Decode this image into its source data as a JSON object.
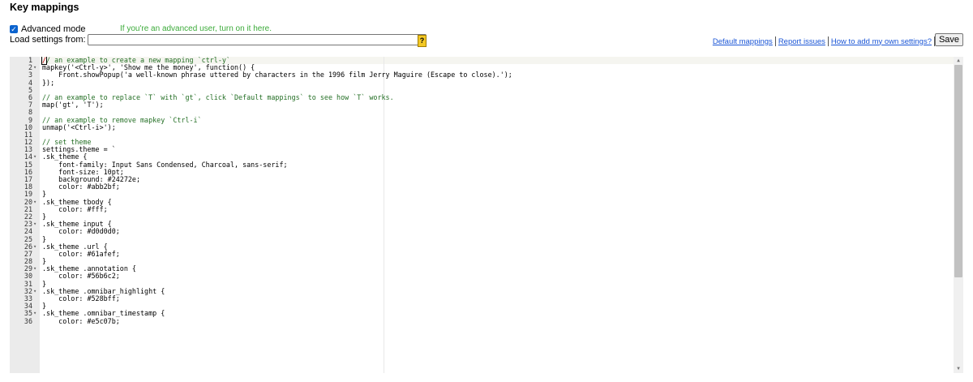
{
  "heading": "Key mappings",
  "advanced": {
    "label": "Advanced mode",
    "checked": true,
    "hint": "If you're an advanced user, turn on it here."
  },
  "load": {
    "label": "Load settings from:",
    "value": "",
    "help_icon": "?"
  },
  "links": {
    "default_mappings": "Default mappings",
    "report_issues": "Report issues",
    "how_to_add": "How to add my own settings?"
  },
  "save_label": "Save",
  "editor": {
    "lines": [
      {
        "n": "1",
        "fold": "",
        "text": "// an example to create a new mapping `ctrl-y`",
        "cls": "comment"
      },
      {
        "n": "2",
        "fold": "▾",
        "text": "mapkey('<Ctrl-y>', 'Show me the money', function() {",
        "cls": ""
      },
      {
        "n": "3",
        "fold": "",
        "text": "    Front.showPopup('a well-known phrase uttered by characters in the 1996 film Jerry Maguire (Escape to close).');",
        "cls": ""
      },
      {
        "n": "4",
        "fold": "",
        "text": "});",
        "cls": ""
      },
      {
        "n": "5",
        "fold": "",
        "text": "",
        "cls": ""
      },
      {
        "n": "6",
        "fold": "",
        "text": "// an example to replace `T` with `gt`, click `Default mappings` to see how `T` works.",
        "cls": "comment"
      },
      {
        "n": "7",
        "fold": "",
        "text": "map('gt', 'T');",
        "cls": ""
      },
      {
        "n": "8",
        "fold": "",
        "text": "",
        "cls": ""
      },
      {
        "n": "9",
        "fold": "",
        "text": "// an example to remove mapkey `Ctrl-i`",
        "cls": "comment"
      },
      {
        "n": "10",
        "fold": "",
        "text": "unmap('<Ctrl-i>');",
        "cls": ""
      },
      {
        "n": "11",
        "fold": "",
        "text": "",
        "cls": ""
      },
      {
        "n": "12",
        "fold": "",
        "text": "// set theme",
        "cls": "comment"
      },
      {
        "n": "13",
        "fold": "",
        "text": "settings.theme = `",
        "cls": ""
      },
      {
        "n": "14",
        "fold": "▾",
        "text": ".sk_theme {",
        "cls": ""
      },
      {
        "n": "15",
        "fold": "",
        "text": "    font-family: Input Sans Condensed, Charcoal, sans-serif;",
        "cls": ""
      },
      {
        "n": "16",
        "fold": "",
        "text": "    font-size: 10pt;",
        "cls": ""
      },
      {
        "n": "17",
        "fold": "",
        "text": "    background: #24272e;",
        "cls": ""
      },
      {
        "n": "18",
        "fold": "",
        "text": "    color: #abb2bf;",
        "cls": ""
      },
      {
        "n": "19",
        "fold": "",
        "text": "}",
        "cls": ""
      },
      {
        "n": "20",
        "fold": "▾",
        "text": ".sk_theme tbody {",
        "cls": ""
      },
      {
        "n": "21",
        "fold": "",
        "text": "    color: #fff;",
        "cls": ""
      },
      {
        "n": "22",
        "fold": "",
        "text": "}",
        "cls": ""
      },
      {
        "n": "23",
        "fold": "▾",
        "text": ".sk_theme input {",
        "cls": ""
      },
      {
        "n": "24",
        "fold": "",
        "text": "    color: #d0d0d0;",
        "cls": ""
      },
      {
        "n": "25",
        "fold": "",
        "text": "}",
        "cls": ""
      },
      {
        "n": "26",
        "fold": "▾",
        "text": ".sk_theme .url {",
        "cls": ""
      },
      {
        "n": "27",
        "fold": "",
        "text": "    color: #61afef;",
        "cls": ""
      },
      {
        "n": "28",
        "fold": "",
        "text": "}",
        "cls": ""
      },
      {
        "n": "29",
        "fold": "▾",
        "text": ".sk_theme .annotation {",
        "cls": ""
      },
      {
        "n": "30",
        "fold": "",
        "text": "    color: #56b6c2;",
        "cls": ""
      },
      {
        "n": "31",
        "fold": "",
        "text": "}",
        "cls": ""
      },
      {
        "n": "32",
        "fold": "▾",
        "text": ".sk_theme .omnibar_highlight {",
        "cls": ""
      },
      {
        "n": "33",
        "fold": "",
        "text": "    color: #528bff;",
        "cls": ""
      },
      {
        "n": "34",
        "fold": "",
        "text": "}",
        "cls": ""
      },
      {
        "n": "35",
        "fold": "▾",
        "text": ".sk_theme .omnibar_timestamp {",
        "cls": ""
      },
      {
        "n": "36",
        "fold": "",
        "text": "    color: #e5c07b;",
        "cls": ""
      }
    ]
  },
  "colors": {
    "link": "#1a55d6",
    "hint_green": "#3cab3a",
    "checkbox_blue": "#0b63ce",
    "comment_green": "#236e24"
  }
}
